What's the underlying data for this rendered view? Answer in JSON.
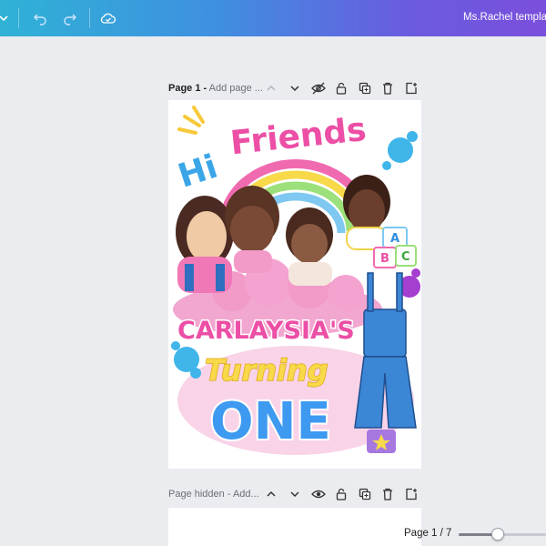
{
  "topbar": {
    "title": "Ms.Rachel templat",
    "menu_icon": "chevron-down-icon",
    "undo_icon": "undo-icon",
    "redo_icon": "redo-icon",
    "cloud_icon": "cloud-saved-icon"
  },
  "pages": [
    {
      "number_label": "Page 1 -",
      "title_placeholder": "Add page ..."
    },
    {
      "number_label": "Page hidden -",
      "title_placeholder": "Add..."
    }
  ],
  "flyer": {
    "line1": "Hi",
    "line2": "Friends",
    "name": "CARLAYSIA'S",
    "turning": "Turning",
    "age": "ONE",
    "blocks": [
      "A",
      "B",
      "C"
    ]
  },
  "footer": {
    "page_count": "Page 1 / 7",
    "zoom_fraction": 0.45
  },
  "colors": {
    "topbar_start": "#2fb2d6",
    "topbar_end": "#7a4fdc",
    "pink": "#ec4fa5",
    "blue": "#2f8ee0",
    "yellow": "#f7d94a"
  }
}
